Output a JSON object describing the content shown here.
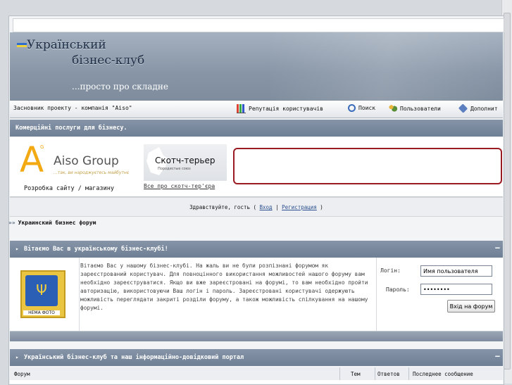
{
  "header": {
    "logo_line1": "Український",
    "logo_line2": "бізнес-клуб",
    "slogan": "...просто про складне"
  },
  "navbar": {
    "founder": "Засновник проекту - компанія \"Aiso\"",
    "items": [
      {
        "label": "Репутація користувачів",
        "icon": "chart-icon"
      },
      {
        "label": "Поиск",
        "icon": "search-icon"
      },
      {
        "label": "Пользователи",
        "icon": "users-icon"
      },
      {
        "label": "Дополнит",
        "icon": "help-icon"
      }
    ]
  },
  "ad_section": {
    "title": "Комерційні послуги для бізнесу.",
    "aiso": {
      "logo_letter": "A",
      "logo_sup": "G",
      "name": "Aiso Group",
      "tagline": "...так, ви народжуєтесь майбутнє",
      "caption": "Розробка сайту / магазину"
    },
    "scotch": {
      "title": "Скотч-терьер",
      "subtitle": "Породистые союз",
      "caption": "Все про скотч-тер'єра"
    }
  },
  "welcome_bar": {
    "prefix": "Здравствуйте, гость ( ",
    "login_link": "Вход",
    "divider": " | ",
    "register_link": "Регистрация",
    "suffix": " )"
  },
  "breadcrumb": "Украинский бизнес форум",
  "intro": {
    "title": "Вітаємо Вас в українському бізнес-клубі!",
    "emblem_label": "НЕМА ФОТО",
    "text": "Вітаємо Вас у нашому бізнес-клубі. На жаль ви не були розпізнані форумом як зареєстрований користувач. Для повноцінного використання можливостей нашого форуму вам необхідно зареєструватися. Якщо ви вже зареєстровані на форумі, то вам необхідно пройти авторизацію, використовуючи Ваш логін і пароль. Зареєстровані користувачі одержують можливість переглядати закриті розділи форуму, а також можливість спілкування на нашому форумі.",
    "login_label": "Логін:",
    "login_value": "Имя пользователя",
    "password_label": "Пароль:",
    "password_value": "••••••••",
    "submit_label": "Вхід на форум"
  },
  "forum_section": {
    "title": "Український бізнес-клуб та наш інформаційно-довідковий портал",
    "columns": [
      "Форум",
      "Тем",
      "Ответов",
      "Последнее сообщение"
    ]
  },
  "minus_symbol": "−",
  "arrow_symbol": "▸",
  "bullet_symbol": "»»"
}
